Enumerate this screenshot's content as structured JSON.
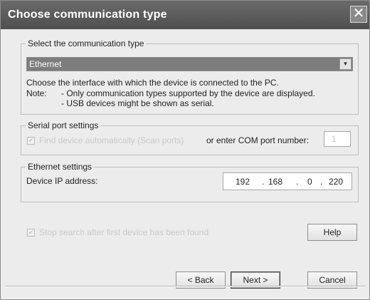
{
  "window": {
    "title": "Choose communication type"
  },
  "comm_group": {
    "legend": "Select the communication type",
    "selected_value": "Ethernet",
    "description": "Choose the interface with which the device is connected to the PC.",
    "note_label": "Note:",
    "note_line1": "- Only communication types supported by the device are displayed.",
    "note_line2": "- USB devices might be shown as serial."
  },
  "serial_group": {
    "legend": "Serial port settings",
    "find_auto_label": "Find device automatically (Scan ports)",
    "or_enter_label": "or enter COM port number:",
    "com_port_value": "1"
  },
  "ethernet_group": {
    "legend": "Ethernet settings",
    "ip_label": "Device IP address:",
    "ip_octets": [
      "192",
      "168",
      "0",
      "220"
    ]
  },
  "stop_search_label": "Stop search after first device has been found",
  "buttons": {
    "help": "Help",
    "back": "< Back",
    "next": "Next >",
    "cancel": "Cancel"
  }
}
